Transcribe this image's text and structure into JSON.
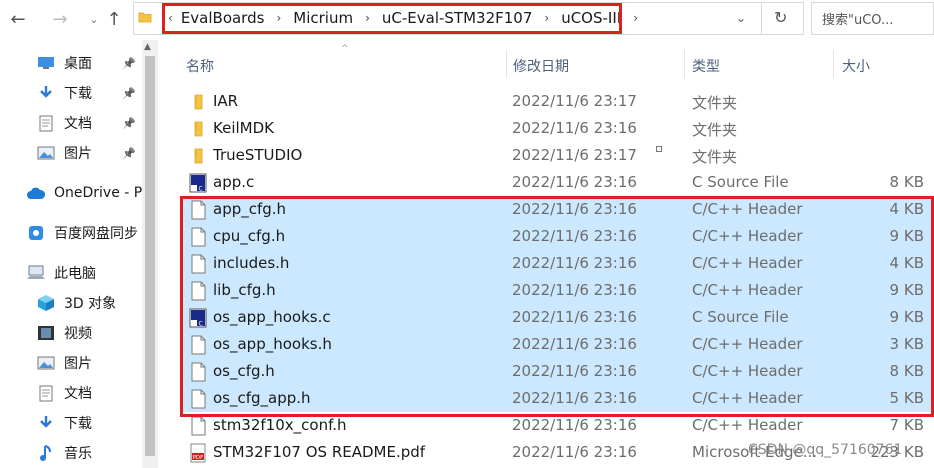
{
  "address": {
    "crumbs": [
      "EvalBoards",
      "Micrium",
      "uC-Eval-STM32F107",
      "uCOS-III"
    ],
    "search_placeholder": "搜索\"uCO..."
  },
  "sidebar": {
    "items": [
      {
        "label": "桌面",
        "icon": "desktop-icon",
        "pinned": true
      },
      {
        "label": "下载",
        "icon": "download-icon",
        "pinned": true
      },
      {
        "label": "文档",
        "icon": "document-icon",
        "pinned": true
      },
      {
        "label": "图片",
        "icon": "picture-icon",
        "pinned": true
      },
      {
        "label": "OneDrive - P",
        "icon": "cloud-icon"
      },
      {
        "label": "百度网盘同步",
        "icon": "baidu-netdisk-icon"
      },
      {
        "label": "此电脑",
        "icon": "computer-icon"
      },
      {
        "label": "3D 对象",
        "icon": "cube-icon"
      },
      {
        "label": "视频",
        "icon": "video-icon"
      },
      {
        "label": "图片",
        "icon": "picture-icon"
      },
      {
        "label": "文档",
        "icon": "document-icon"
      },
      {
        "label": "下载",
        "icon": "download-icon"
      },
      {
        "label": "音乐",
        "icon": "music-icon"
      }
    ]
  },
  "columns": {
    "name": "名称",
    "date": "修改日期",
    "type": "类型",
    "size": "大小"
  },
  "files": [
    {
      "name": "IAR",
      "date": "2022/11/6 23:17",
      "type": "文件夹",
      "size": "",
      "icon": "folder",
      "selected": false
    },
    {
      "name": "KeilMDK",
      "date": "2022/11/6 23:16",
      "type": "文件夹",
      "size": "",
      "icon": "folder",
      "selected": false
    },
    {
      "name": "TrueSTUDIO",
      "date": "2022/11/6 23:17",
      "type": "文件夹",
      "size": "",
      "icon": "folder",
      "selected": false
    },
    {
      "name": "app.c",
      "date": "2022/11/6 23:16",
      "type": "C Source File",
      "size": "8 KB",
      "icon": "c-source",
      "selected": false
    },
    {
      "name": "app_cfg.h",
      "date": "2022/11/6 23:16",
      "type": "C/C++ Header",
      "size": "4 KB",
      "icon": "header",
      "selected": true
    },
    {
      "name": "cpu_cfg.h",
      "date": "2022/11/6 23:16",
      "type": "C/C++ Header",
      "size": "9 KB",
      "icon": "header",
      "selected": true
    },
    {
      "name": "includes.h",
      "date": "2022/11/6 23:16",
      "type": "C/C++ Header",
      "size": "4 KB",
      "icon": "header",
      "selected": true
    },
    {
      "name": "lib_cfg.h",
      "date": "2022/11/6 23:16",
      "type": "C/C++ Header",
      "size": "9 KB",
      "icon": "header",
      "selected": true
    },
    {
      "name": "os_app_hooks.c",
      "date": "2022/11/6 23:16",
      "type": "C Source File",
      "size": "9 KB",
      "icon": "c-source",
      "selected": true
    },
    {
      "name": "os_app_hooks.h",
      "date": "2022/11/6 23:16",
      "type": "C/C++ Header",
      "size": "3 KB",
      "icon": "header",
      "selected": true
    },
    {
      "name": "os_cfg.h",
      "date": "2022/11/6 23:16",
      "type": "C/C++ Header",
      "size": "8 KB",
      "icon": "header",
      "selected": true
    },
    {
      "name": "os_cfg_app.h",
      "date": "2022/11/6 23:16",
      "type": "C/C++ Header",
      "size": "5 KB",
      "icon": "header",
      "selected": true
    },
    {
      "name": "stm32f10x_conf.h",
      "date": "2022/11/6 23:16",
      "type": "C/C++ Header",
      "size": "7 KB",
      "icon": "header",
      "selected": false
    },
    {
      "name": "STM32F107 OS README.pdf",
      "date": "2022/11/6 23:16",
      "type": "Microsoft Edge...",
      "size": "223 KB",
      "icon": "pdf",
      "selected": false
    }
  ],
  "watermark": "CSDN @qq_57160761",
  "colors": {
    "selection": "#cce8ff",
    "highlight_border": "#e02020",
    "folder": "#f5c343"
  }
}
